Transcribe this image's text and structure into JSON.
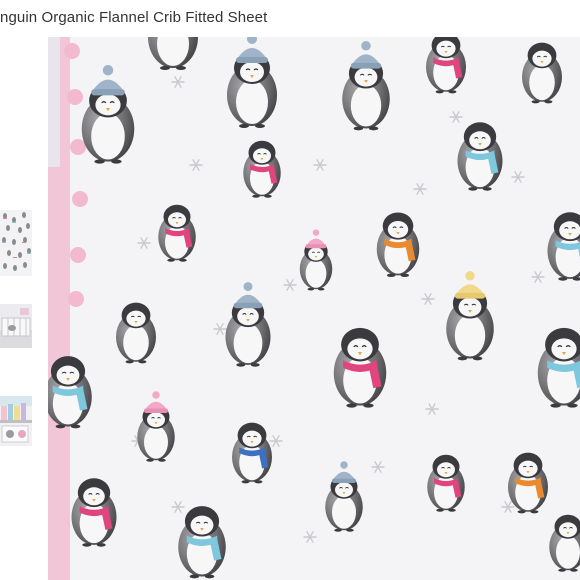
{
  "product": {
    "title": "nguin Organic Flannel Crib Fitted Sheet"
  },
  "gallery": {
    "thumbnails": [
      {
        "name": "thumbnail-pattern-swatch",
        "icon": "penguin-pattern-thumbnail"
      },
      {
        "name": "thumbnail-crib-room",
        "icon": "crib-room-thumbnail"
      },
      {
        "name": "thumbnail-nursery-shelf",
        "icon": "nursery-shelf-thumbnail"
      }
    ],
    "main_image": {
      "icon": "penguin-pattern-fabric-image"
    }
  },
  "colors": {
    "fabric_bg": "#f4f3f6",
    "penguin_body": "#6f6f72",
    "penguin_belly": "#f7f7f8",
    "pink_trim": "#f1c6d6",
    "scarf_pink": "#e0457e",
    "scarf_blue": "#7fc7dc",
    "scarf_orange": "#e98a2e",
    "hat_yellow": "#f2d889",
    "hat_blue": "#9fb4c8",
    "snowflake": "#c9c9ce"
  }
}
